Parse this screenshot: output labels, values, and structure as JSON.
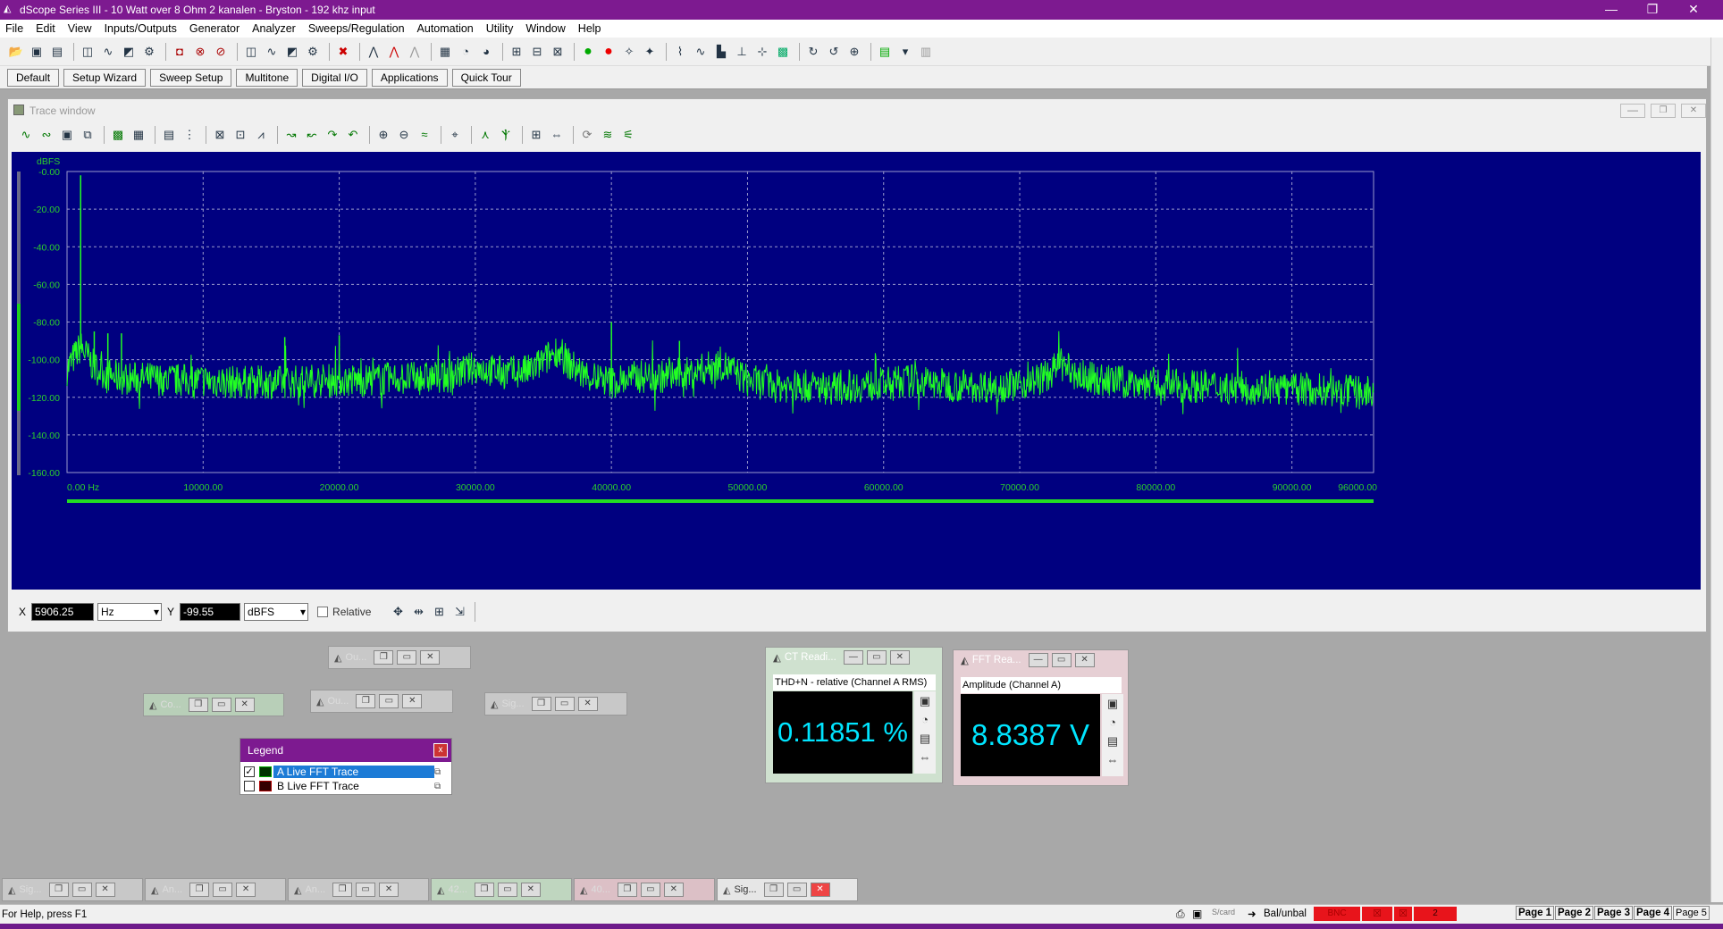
{
  "window": {
    "title": "dScope Series III - 10 Watt over 8 Ohm 2 kanalen - Bryston - 192 khz input"
  },
  "menu": [
    "File",
    "Edit",
    "View",
    "Inputs/Outputs",
    "Generator",
    "Analyzer",
    "Sweeps/Regulation",
    "Automation",
    "Utility",
    "Window",
    "Help"
  ],
  "nav_buttons": [
    "Default",
    "Setup Wizard",
    "Sweep Setup",
    "Multitone",
    "Digital I/O",
    "Applications",
    "Quick Tour"
  ],
  "trace_window": {
    "title": "Trace window"
  },
  "chart_data": {
    "type": "line",
    "ylabel": "dBFS",
    "y_ticks": [
      "-0.00",
      "-20.00",
      "-40.00",
      "-60.00",
      "-80.00",
      "-100.00",
      "-120.00",
      "-140.00",
      "-160.00"
    ],
    "x_ticks": [
      "0.00 Hz",
      "10000.00",
      "20000.00",
      "30000.00",
      "40000.00",
      "50000.00",
      "60000.00",
      "70000.00",
      "80000.00",
      "90000.00",
      "96000.00"
    ],
    "xlim": [
      0,
      96000
    ],
    "ylim": [
      -160,
      0
    ],
    "grid": true,
    "series": [
      {
        "name": "A Live FFT Trace",
        "color": "#22ff22",
        "x": [
          0,
          1000,
          2000,
          3000,
          4000,
          6000,
          8000,
          10000,
          12000,
          14000,
          16000,
          18000,
          20000,
          22000,
          24000,
          26000,
          28000,
          30000,
          32000,
          34000,
          35000,
          36000,
          37000,
          38000,
          40000,
          42000,
          44000,
          46000,
          48000,
          50000,
          52000,
          54000,
          56000,
          58000,
          60000,
          62000,
          64000,
          66000,
          68000,
          70000,
          72000,
          73000,
          74000,
          76000,
          78000,
          80000,
          82000,
          84000,
          86000,
          88000,
          90000,
          92000,
          94000,
          96000
        ],
        "y": [
          -105,
          -93,
          -104,
          -108,
          -110,
          -110,
          -111,
          -111,
          -112,
          -112,
          -112,
          -111,
          -111,
          -111,
          -110,
          -110,
          -109,
          -104,
          -107,
          -106,
          -101,
          -95,
          -103,
          -108,
          -112,
          -109,
          -109,
          -107,
          -102,
          -111,
          -114,
          -114,
          -115,
          -114,
          -113,
          -111,
          -113,
          -114,
          -114,
          -113,
          -109,
          -102,
          -108,
          -111,
          -112,
          -113,
          -114,
          -114,
          -115,
          -115,
          -116,
          -116,
          -117,
          -118
        ]
      }
    ],
    "spikes": [
      {
        "x": 1000,
        "y": -2
      },
      {
        "x": 2000,
        "y": -85
      },
      {
        "x": 3000,
        "y": -86
      },
      {
        "x": 4000,
        "y": -86
      },
      {
        "x": 16000,
        "y": -88
      },
      {
        "x": 20000,
        "y": -87
      },
      {
        "x": 40000,
        "y": -80
      },
      {
        "x": 45000,
        "y": -90
      }
    ]
  },
  "cursor": {
    "x_label": "X",
    "x_value": "5906.25",
    "x_unit": "Hz",
    "y_label": "Y",
    "y_value": "-99.55",
    "y_unit": "dBFS",
    "relative_label": "Relative"
  },
  "mini_windows": [
    {
      "title": "Ou..."
    },
    {
      "title": "Co..."
    },
    {
      "title": "Ou..."
    },
    {
      "title": "Sig..."
    }
  ],
  "legend": {
    "title": "Legend",
    "close": "x",
    "items": [
      {
        "label": "A  Live FFT Trace",
        "checked": true
      },
      {
        "label": "B  Live FFT Trace",
        "checked": false
      }
    ]
  },
  "thd_meter": {
    "title": "CT Readi...",
    "subtitle": "THD+N - relative (Channel A RMS)",
    "value": "0.11851 %"
  },
  "amp_meter": {
    "title": "FFT Rea...",
    "subtitle": "Amplitude (Channel A)",
    "value": "8.8387 V"
  },
  "bottom_windows": [
    {
      "title": "Sig..."
    },
    {
      "title": "An..."
    },
    {
      "title": "An..."
    },
    {
      "title": "42..."
    },
    {
      "title": "40..."
    },
    {
      "title": "Sig..."
    }
  ],
  "status": {
    "help": "For Help, press F1",
    "balunbal": "Bal/unbal",
    "bnc": "BNC",
    "s_card": "S/card",
    "num2": "2",
    "pages": [
      "Page 1",
      "Page 2",
      "Page 3",
      "Page 4",
      "Page 5"
    ]
  }
}
